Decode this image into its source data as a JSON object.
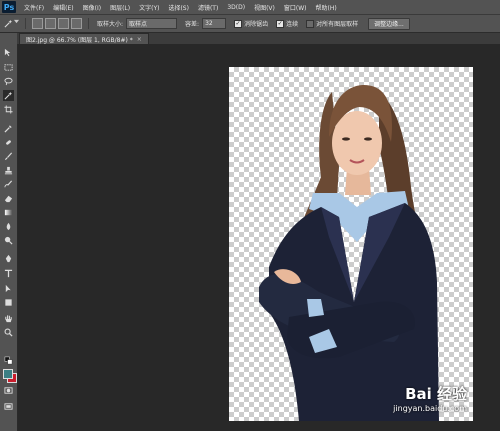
{
  "app": {
    "logo_text": "Ps"
  },
  "menu": [
    "文件(F)",
    "编辑(E)",
    "图像(I)",
    "图层(L)",
    "文字(Y)",
    "选择(S)",
    "滤镜(T)",
    "3D(D)",
    "视图(V)",
    "窗口(W)",
    "帮助(H)"
  ],
  "options": {
    "sample_size_label": "取样大小:",
    "sample_size_value": "取样点",
    "tolerance_label": "容差:",
    "tolerance_value": "32",
    "antialias_label": "消除锯齿",
    "antialias_checked": true,
    "contiguous_label": "连续",
    "contiguous_checked": true,
    "sample_all_label": "对所有图层取样",
    "sample_all_checked": false,
    "refine_edge_button": "调整边缘..."
  },
  "document_tab": {
    "title": "图2.jpg @ 66.7% (图层 1, RGB/8#) *",
    "close": "×"
  },
  "colors": {
    "foreground": "#3b7f84",
    "background": "#c81e2d",
    "app_bg": "#282828",
    "panel": "#535353"
  },
  "tools": [
    "move-tool",
    "marquee-tool",
    "lasso-tool",
    "magic-wand-tool",
    "crop-tool",
    "eyedropper-tool",
    "healing-brush-tool",
    "brush-tool",
    "clone-stamp-tool",
    "history-brush-tool",
    "eraser-tool",
    "gradient-tool",
    "blur-tool",
    "dodge-tool",
    "pen-tool",
    "type-tool",
    "path-selection-tool",
    "shape-tool",
    "hand-tool",
    "zoom-tool"
  ],
  "watermark": {
    "logo": "Bai 经验",
    "url": "jingyan.baidu.com"
  }
}
